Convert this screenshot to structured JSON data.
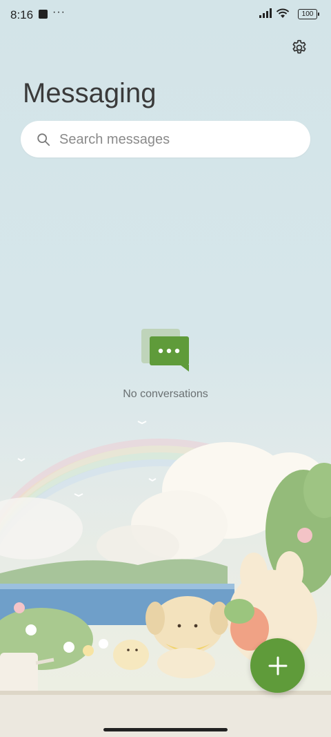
{
  "status_bar": {
    "time": "8:16",
    "dots": "···",
    "battery": "100"
  },
  "header": {
    "title": "Messaging"
  },
  "search": {
    "placeholder": "Search messages"
  },
  "empty_state": {
    "text": "No conversations"
  },
  "colors": {
    "accent": "#5f9b3a",
    "background": "#d3e4e8"
  },
  "icons": {
    "settings": "gear-icon",
    "search": "search-icon",
    "empty": "chat-bubbles-icon",
    "fab": "plus-icon"
  }
}
